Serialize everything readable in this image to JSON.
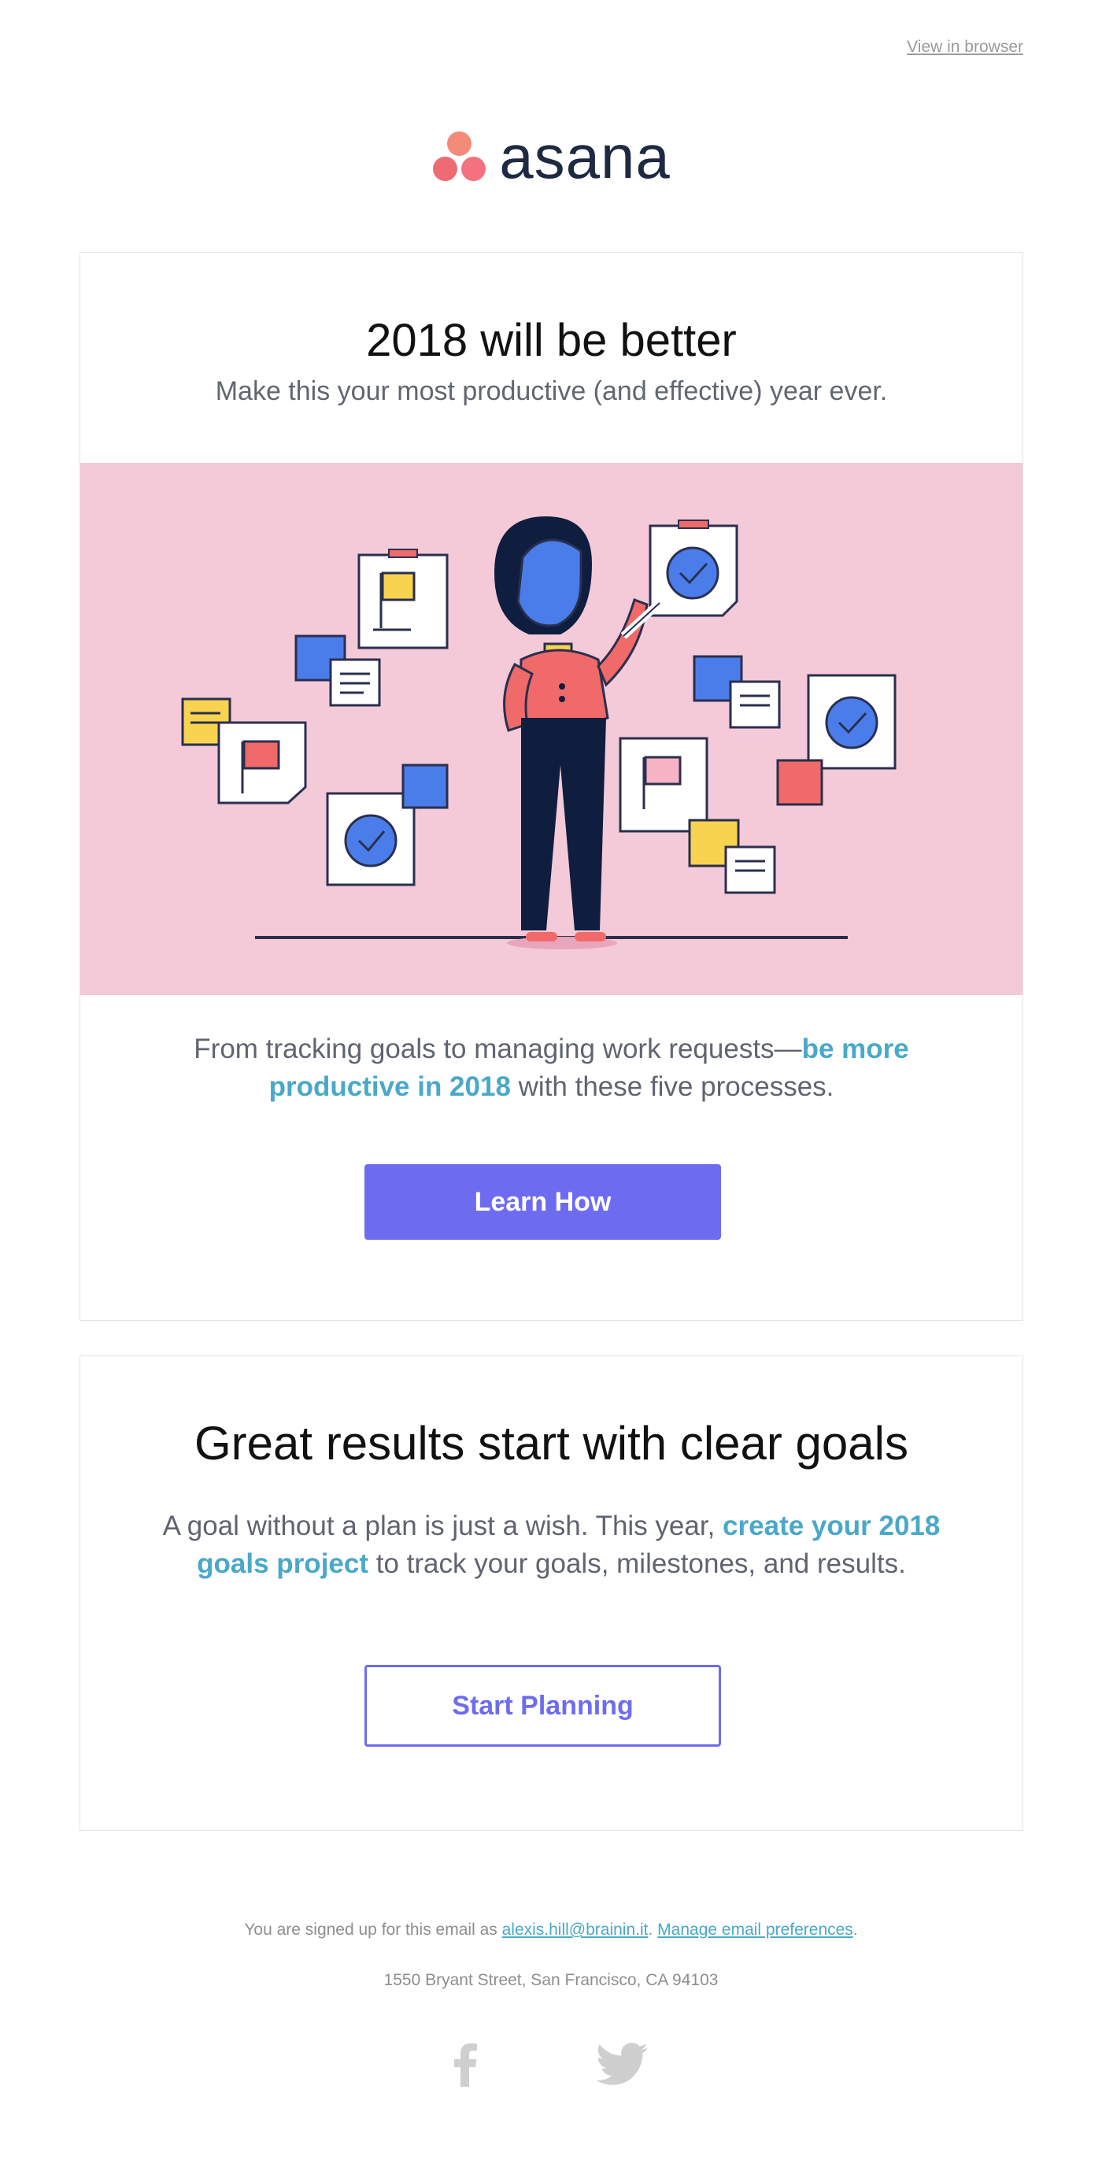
{
  "header": {
    "view_in_browser": "View in browser"
  },
  "brand": {
    "logo_text": "asana"
  },
  "card1": {
    "title": "2018 will be better",
    "subtitle": "Make this your most productive (and effective) year ever.",
    "body_pre": "From tracking goals to managing work requests—",
    "body_link": "be more productive in 2018",
    "body_post": " with these five processes.",
    "cta": "Learn How"
  },
  "card2": {
    "title": "Great results start with clear goals",
    "body_pre": "A goal without a plan is just a wish. This year, ",
    "body_link": "create your 2018 goals project",
    "body_post": " to track your goals, milestones, and results.",
    "cta": "Start Planning"
  },
  "footer": {
    "signed_pre": "You are signed up for this email as ",
    "email": "alexis.hill@brainin.it",
    "sep": ". ",
    "manage": "Manage email preferences",
    "end": ".",
    "address": "1550 Bryant Street, San Francisco, CA 94103",
    "social_icons": [
      "facebook-icon",
      "twitter-icon"
    ]
  },
  "colors": {
    "accent": "#6d6cf0",
    "link": "#4aa8c8",
    "hero_bg": "#f4c9d8"
  }
}
